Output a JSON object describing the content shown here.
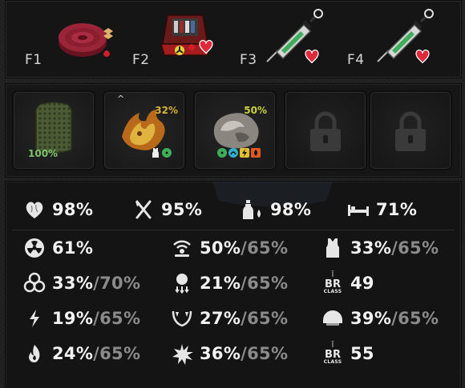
{
  "quick_slots": [
    {
      "key": "F1",
      "item": "bandage-roll"
    },
    {
      "key": "F2",
      "item": "medkit"
    },
    {
      "key": "F3",
      "item": "syringe"
    },
    {
      "key": "F4",
      "item": "syringe"
    }
  ],
  "equipment_slots": [
    {
      "item": "armor-plate",
      "value": "100%",
      "color": "#7fc46b"
    },
    {
      "item": "artifact-flame",
      "value": "32%",
      "color": "#d6b23a"
    },
    {
      "item": "artifact-stone",
      "value": "50%",
      "color": "#c9d23a"
    },
    {
      "item": "locked"
    },
    {
      "item": "locked"
    }
  ],
  "needs": {
    "health": "98%",
    "hunger": "95%",
    "thirst": "98%",
    "sleep": "71%"
  },
  "resistances": {
    "radiation": {
      "value": "61%"
    },
    "biological": {
      "value": "33%",
      "max": "/70%"
    },
    "electric": {
      "value": "19%",
      "max": "/65%"
    },
    "burn": {
      "value": "24%",
      "max": "/65%"
    },
    "psi": {
      "value": "50%",
      "max": "/65%"
    },
    "gravity": {
      "value": "21%",
      "max": "/65%"
    },
    "bite": {
      "value": "27%",
      "max": "/65%"
    },
    "explosion": {
      "value": "36%",
      "max": "/65%"
    },
    "body_armor": {
      "value": "33%",
      "max": "/65%"
    },
    "body_class": {
      "label_top": "BR",
      "label_bottom": "CLASS",
      "value": "49"
    },
    "helmet_armor": {
      "value": "39%",
      "max": "/65%"
    },
    "helmet_class": {
      "label_top": "BR",
      "label_bottom": "CLASS",
      "value": "55"
    }
  }
}
